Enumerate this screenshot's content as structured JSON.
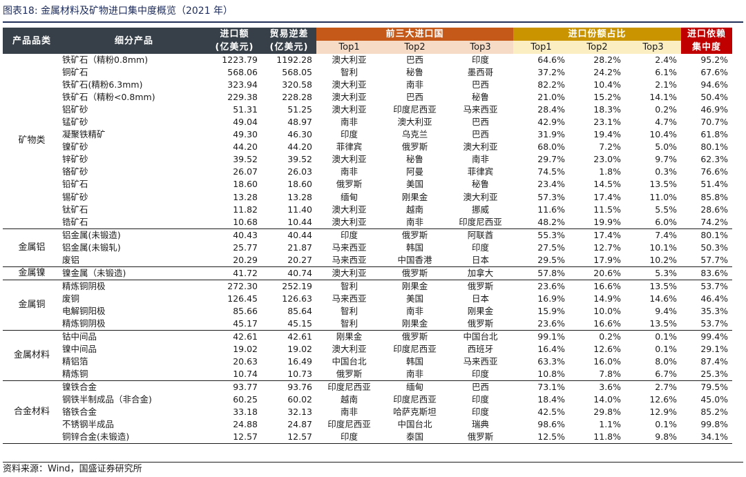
{
  "title": "图表18:  金属材料及矿物进口集中度概览（2021 年）",
  "headers": {
    "category": "产品品类",
    "product": "细分产品",
    "import_l1": "进口额",
    "import_l2": "(亿美元)",
    "trade_l1": "贸易逆差",
    "trade_l2": "(亿美元)",
    "top3_countries": "前三大进口国",
    "share": "进口份额占比",
    "dep_l1": "进口依赖",
    "dep_l2": "集中度",
    "top1": "Top1",
    "top2": "Top2",
    "top3": "Top3",
    "stop1": "Top1",
    "stop2": "Top2",
    "stop3": "Top3"
  },
  "groups": [
    {
      "category": "矿物类",
      "rows": [
        [
          "铁矿石（精粉0.8mm)",
          "1223.79",
          "1192.28",
          "澳大利亚",
          "巴西",
          "印度",
          "64.6%",
          "28.2%",
          "2.4%",
          "95.2%"
        ],
        [
          "铜矿石",
          "568.06",
          "568.05",
          "智利",
          "秘鲁",
          "墨西哥",
          "37.2%",
          "24.2%",
          "6.1%",
          "67.6%"
        ],
        [
          "铁矿石(精粉6.3mm)",
          "323.94",
          "320.58",
          "澳大利亚",
          "南非",
          "巴西",
          "82.2%",
          "10.4%",
          "2.1%",
          "94.6%"
        ],
        [
          "铁矿石（精粉<0.8mm)",
          "229.38",
          "228.28",
          "澳大利亚",
          "巴西",
          "秘鲁",
          "21.0%",
          "15.2%",
          "14.1%",
          "50.4%"
        ],
        [
          "铝矿砂",
          "51.31",
          "51.25",
          "澳大利亚",
          "印度尼西亚",
          "马来西亚",
          "28.4%",
          "18.3%",
          "0.2%",
          "46.9%"
        ],
        [
          "锰矿砂",
          "49.04",
          "48.97",
          "南非",
          "澳大利亚",
          "巴西",
          "42.9%",
          "23.1%",
          "4.7%",
          "70.7%"
        ],
        [
          "凝聚铁精矿",
          "49.30",
          "46.30",
          "印度",
          "乌克兰",
          "巴西",
          "31.9%",
          "19.4%",
          "10.4%",
          "61.8%"
        ],
        [
          "镍矿砂",
          "44.20",
          "44.20",
          "菲律宾",
          "俄罗斯",
          "澳大利亚",
          "68.0%",
          "7.2%",
          "5.0%",
          "80.1%"
        ],
        [
          "锌矿砂",
          "39.52",
          "39.52",
          "澳大利亚",
          "秘鲁",
          "南非",
          "29.7%",
          "23.0%",
          "9.7%",
          "62.3%"
        ],
        [
          "铬矿砂",
          "26.07",
          "26.03",
          "南非",
          "阿曼",
          "菲律宾",
          "74.5%",
          "1.8%",
          "0.3%",
          "76.6%"
        ],
        [
          "铅矿石",
          "18.60",
          "18.60",
          "俄罗斯",
          "美国",
          "秘鲁",
          "23.4%",
          "14.5%",
          "13.5%",
          "51.4%"
        ],
        [
          "锡矿砂",
          "13.28",
          "13.28",
          "缅甸",
          "刚果金",
          "澳大利亚",
          "57.3%",
          "17.4%",
          "11.0%",
          "85.8%"
        ],
        [
          "钛矿石",
          "11.82",
          "11.40",
          "澳大利亚",
          "越南",
          "挪威",
          "11.6%",
          "11.5%",
          "5.5%",
          "28.6%"
        ],
        [
          "锆矿石",
          "10.68",
          "10.44",
          "澳大利亚",
          "南非",
          "印度尼西亚",
          "48.2%",
          "19.9%",
          "6.0%",
          "74.2%"
        ]
      ]
    },
    {
      "category": "金属铝",
      "rows": [
        [
          "铝金属(未锻造)",
          "40.43",
          "40.44",
          "印度",
          "俄罗斯",
          "阿联酋",
          "55.3%",
          "17.4%",
          "7.4%",
          "80.1%"
        ],
        [
          "铝金属(未锻轧)",
          "25.77",
          "21.87",
          "马来西亚",
          "韩国",
          "印度",
          "27.5%",
          "12.7%",
          "10.1%",
          "50.3%"
        ],
        [
          "废铝",
          "20.29",
          "20.27",
          "马来西亚",
          "中国香港",
          "日本",
          "29.5%",
          "17.9%",
          "10.2%",
          "57.7%"
        ]
      ]
    },
    {
      "category": "金属镍",
      "rows": [
        [
          "镍金属（未锻造)",
          "41.72",
          "40.74",
          "澳大利亚",
          "俄罗斯",
          "加拿大",
          "57.8%",
          "20.6%",
          "5.3%",
          "83.6%"
        ]
      ]
    },
    {
      "category": "金属铜",
      "rows": [
        [
          "精炼铜阴极",
          "272.30",
          "252.19",
          "智利",
          "刚果金",
          "俄罗斯",
          "23.6%",
          "16.6%",
          "13.5%",
          "53.7%"
        ],
        [
          "废铜",
          "126.45",
          "126.63",
          "马来西亚",
          "美国",
          "日本",
          "16.9%",
          "14.9%",
          "14.6%",
          "46.4%"
        ],
        [
          "电解铜阳极",
          "85.66",
          "85.64",
          "智利",
          "南非",
          "刚果金",
          "15.9%",
          "10.0%",
          "9.4%",
          "35.3%"
        ],
        [
          "精炼铜阴极",
          "45.17",
          "45.15",
          "智利",
          "刚果金",
          "俄罗斯",
          "23.6%",
          "16.6%",
          "13.5%",
          "53.7%"
        ]
      ]
    },
    {
      "category": "金属材料",
      "rows": [
        [
          "钴中间品",
          "42.61",
          "42.61",
          "刚果金",
          "俄罗斯",
          "中国台北",
          "99.1%",
          "0.2%",
          "0.1%",
          "99.4%"
        ],
        [
          "镍中间品",
          "19.02",
          "19.02",
          "澳大利亚",
          "印度尼西亚",
          "西班牙",
          "16.4%",
          "12.6%",
          "0.1%",
          "29.1%"
        ],
        [
          "精铝箔",
          "20.63",
          "16.49",
          "中国台北",
          "韩国",
          "马来西亚",
          "63.3%",
          "16.0%",
          "8.0%",
          "87.4%"
        ],
        [
          "精炼铜",
          "10.74",
          "10.73",
          "俄罗斯",
          "南非",
          "印度",
          "10.8%",
          "7.8%",
          "6.7%",
          "25.3%"
        ]
      ]
    },
    {
      "category": "合金材料",
      "rows": [
        [
          "镍铁合金",
          "93.77",
          "93.76",
          "印度尼西亚",
          "缅甸",
          "巴西",
          "73.1%",
          "3.6%",
          "2.7%",
          "79.5%"
        ],
        [
          "钢铁半制成品（非合金)",
          "60.25",
          "60.02",
          "越南",
          "印度尼西亚",
          "印度",
          "18.4%",
          "14.0%",
          "12.6%",
          "45.0%"
        ],
        [
          "铬铁合金",
          "33.18",
          "32.13",
          "南非",
          "哈萨克斯坦",
          "印度",
          "42.5%",
          "29.8%",
          "12.9%",
          "85.2%"
        ],
        [
          "不锈钢半成品",
          "24.88",
          "24.87",
          "印度尼西亚",
          "中国台北",
          "瑞典",
          "98.6%",
          "1.1%",
          "0.1%",
          "99.8%"
        ],
        [
          "铜锌合金(未锻造)",
          "12.57",
          "12.57",
          "印度",
          "泰国",
          "俄罗斯",
          "12.5%",
          "11.8%",
          "9.8%",
          "34.1%"
        ]
      ]
    }
  ],
  "source": "资料来源：Wind，国盛证券研究所"
}
